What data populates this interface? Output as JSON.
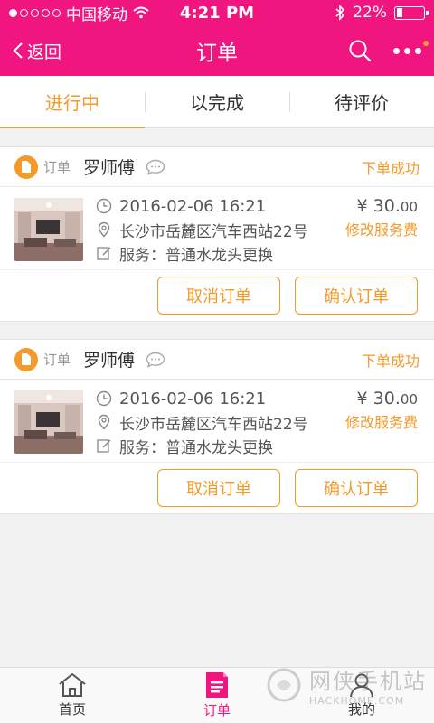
{
  "status_bar": {
    "carrier": "中国移动",
    "time": "4:21 PM",
    "battery": "22%",
    "battery_level": 0.22
  },
  "nav": {
    "back_label": "返回",
    "title": "订单"
  },
  "tabs": [
    {
      "label": "进行中",
      "active": true
    },
    {
      "label": "以完成",
      "active": false
    },
    {
      "label": "待评价",
      "active": false
    }
  ],
  "orders": [
    {
      "tag": "订单",
      "master": "罗师傅",
      "status": "下单成功",
      "datetime": "2016-02-06 16:21",
      "address": "长沙市岳麓区汽车西站22号",
      "service": "服务：普通水龙头更换",
      "price_main": "¥ 30.",
      "price_decimal": "00",
      "modify_fee": "修改服务费",
      "cancel_label": "取消订单",
      "confirm_label": "确认订单"
    },
    {
      "tag": "订单",
      "master": "罗师傅",
      "status": "下单成功",
      "datetime": "2016-02-06 16:21",
      "address": "长沙市岳麓区汽车西站22号",
      "service": "服务：普通水龙头更换",
      "price_main": "¥ 30.",
      "price_decimal": "00",
      "modify_fee": "修改服务费",
      "cancel_label": "取消订单",
      "confirm_label": "确认订单"
    }
  ],
  "bottom_nav": [
    {
      "label": "首页",
      "icon": "home-icon",
      "active": false
    },
    {
      "label": "订单",
      "icon": "order-icon",
      "active": true
    },
    {
      "label": "我的",
      "icon": "user-icon",
      "active": false
    }
  ],
  "watermark": {
    "text": "网侠手机站",
    "url_text": "HACKHOME.COM"
  },
  "colors": {
    "brand_pink": "#f0157f",
    "accent_orange": "#f39a2c"
  }
}
